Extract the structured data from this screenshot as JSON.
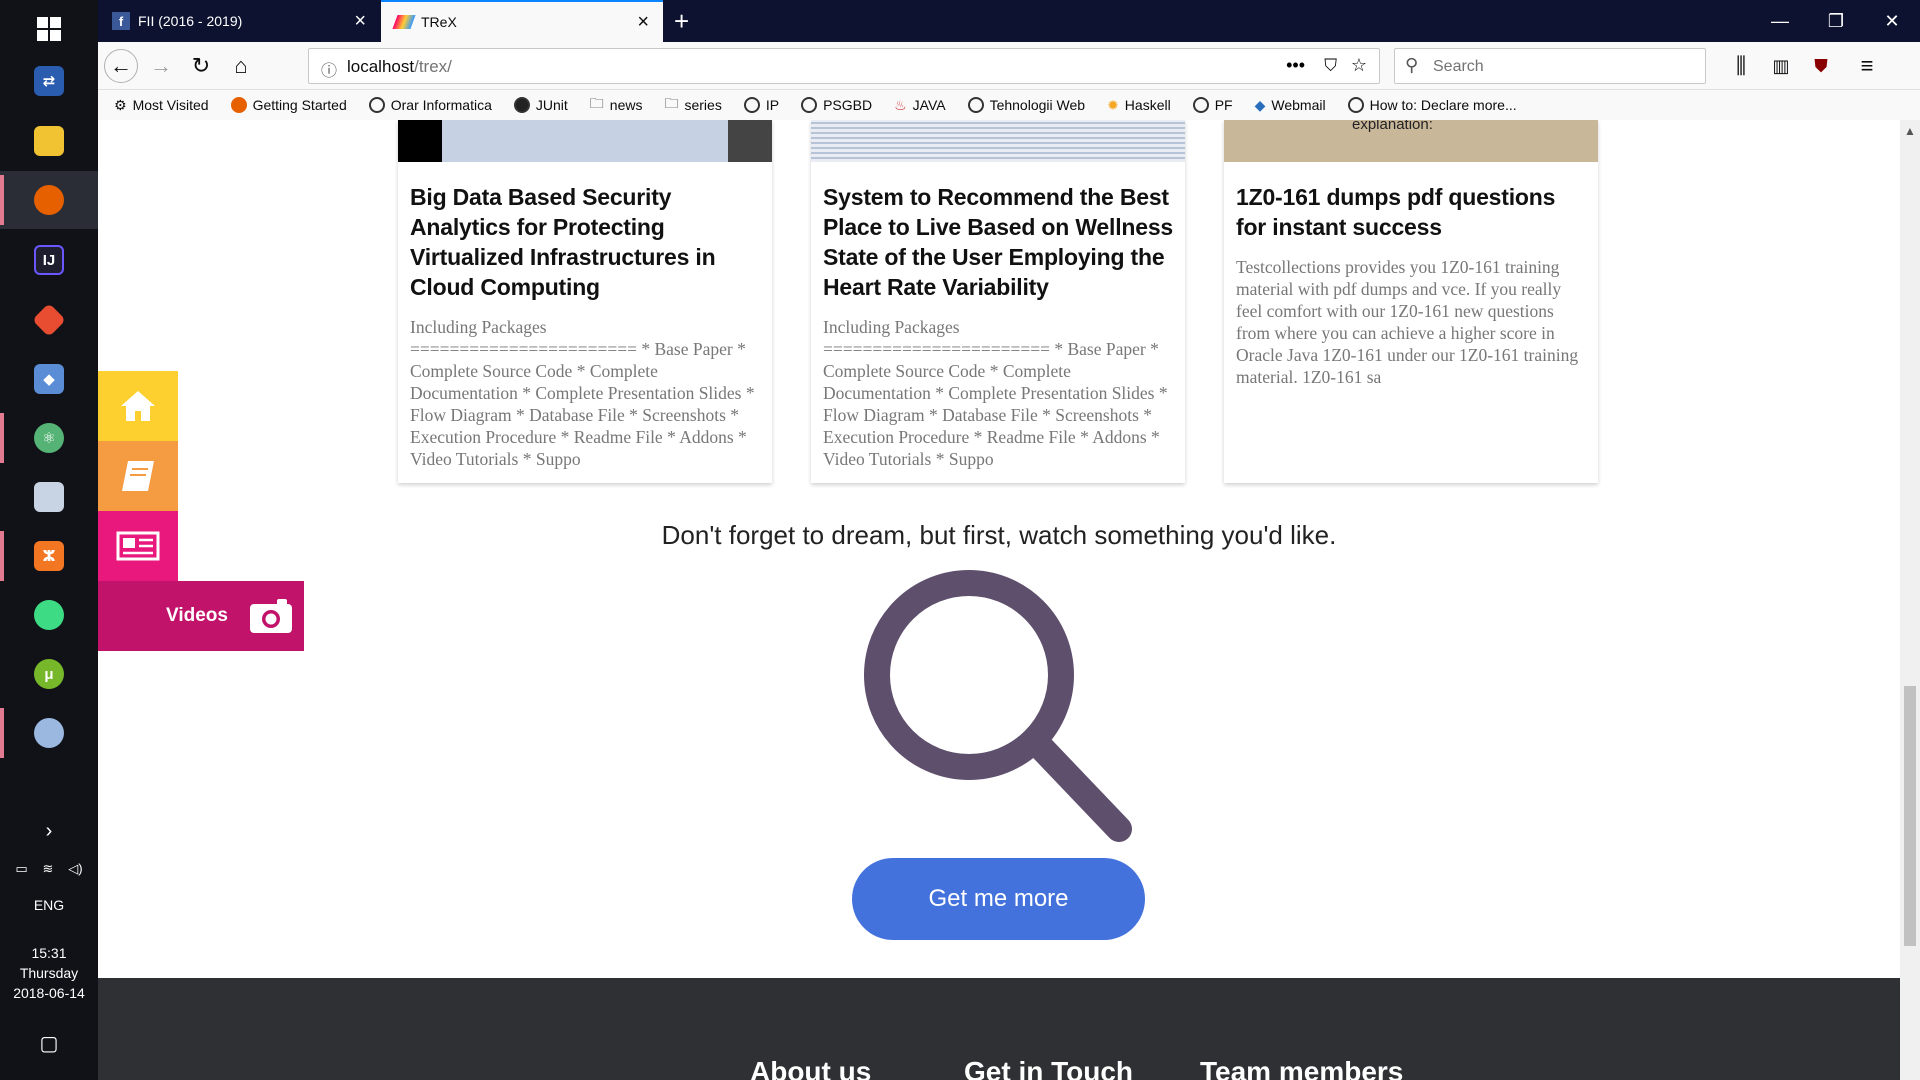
{
  "taskbar": {
    "tray": {
      "language": "ENG",
      "time": "15:31",
      "day": "Thursday",
      "date": "2018-06-14"
    }
  },
  "browser": {
    "tabs": [
      {
        "label": "FII (2016 - 2019)",
        "active": false
      },
      {
        "label": "TReX",
        "active": true
      }
    ],
    "url_host": "localhost",
    "url_path": "/trex/",
    "search_placeholder": "Search",
    "bookmarks": [
      "Most Visited",
      "Getting Started",
      "Orar Informatica",
      "JUnit",
      "news",
      "series",
      "IP",
      "PSGBD",
      "JAVA",
      "Tehnologii Web",
      "Haskell",
      "PF",
      "Webmail",
      "How to: Declare more..."
    ]
  },
  "cards": [
    {
      "title": "Big Data Based Security Analytics for Protecting Virtualized Infrastructures in Cloud Computing",
      "body": "Including Packages ======================= * Base Paper * Complete Source Code * Complete Documentation * Complete Presentation Slides * Flow Diagram * Database File * Screenshots * Execution Procedure * Readme File * Addons * Video Tutorials * Suppo"
    },
    {
      "title": "System to Recommend the Best Place to Live Based on Wellness State of the User Employing the Heart Rate Variability",
      "body": "Including Packages ======================= * Base Paper * Complete Source Code * Complete Documentation * Complete Presentation Slides * Flow Diagram * Database File * Screenshots * Execution Procedure * Readme File * Addons * Video Tutorials * Suppo"
    },
    {
      "title": "1Z0-161 dumps pdf questions for instant success",
      "thumb_caption": "explanation:",
      "body": "Testcollections provides you 1Z0-161 training material with pdf dumps and vce. If you really feel comfort with our 1Z0-161 new questions from where you can achieve a higher score in Oracle Java 1Z0-161 under our 1Z0-161 training material. 1Z0-161 sa"
    }
  ],
  "side_nav": {
    "videos_label": "Videos"
  },
  "main": {
    "tagline": "Don't forget to dream, but first, watch something you'd like.",
    "more_button": "Get me more"
  },
  "footer": {
    "headings": [
      "About us",
      "Get in Touch",
      "Team members"
    ]
  },
  "colors": {
    "side_home": "#fed02f",
    "side_books": "#f59b42",
    "side_news": "#e8187d",
    "side_videos": "#c2136a",
    "accent_button": "#4372dd",
    "search_icon": "#5e4f6c"
  }
}
